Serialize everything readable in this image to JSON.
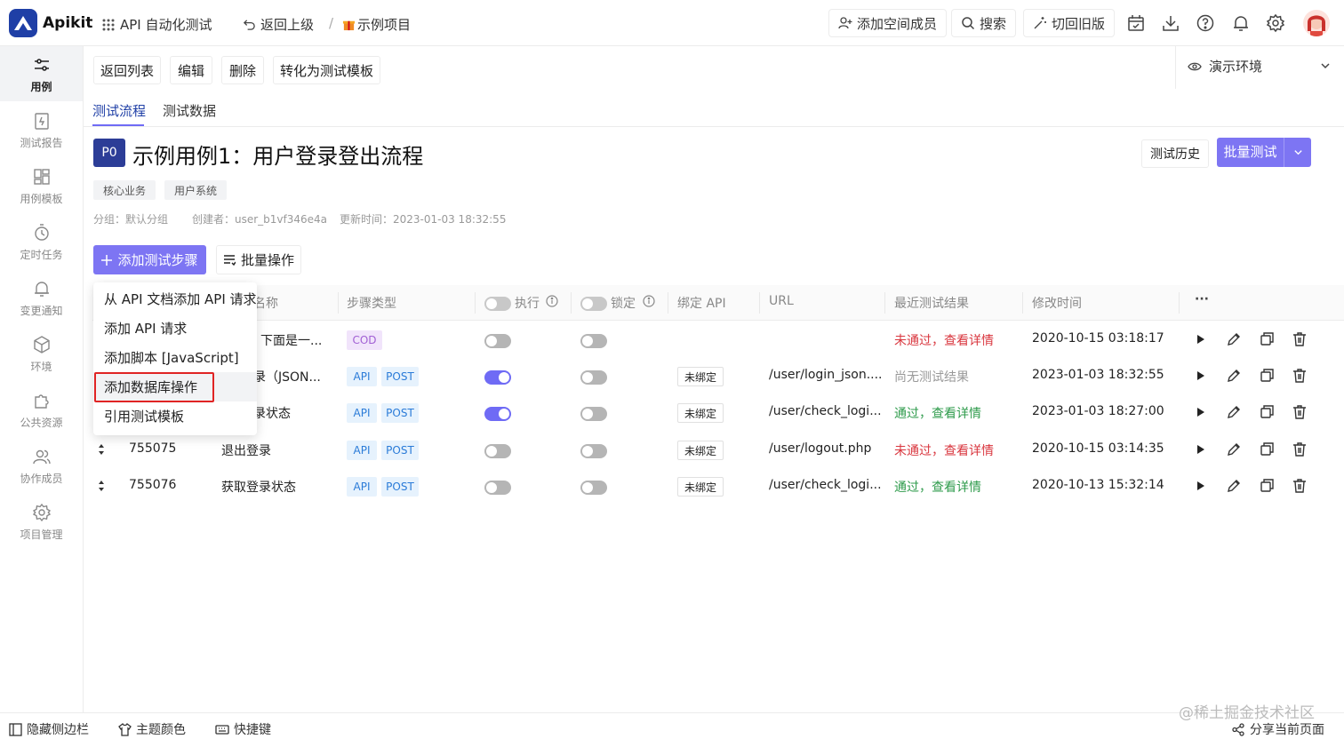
{
  "app": {
    "brand": "Apikit"
  },
  "topbar": {
    "module": "API 自动化测试",
    "back": "返回上级",
    "sep": "/",
    "project": "示例项目",
    "add_member": "添加空间成员",
    "search": "搜索",
    "old_version": "切回旧版"
  },
  "sidebar": {
    "items": [
      {
        "label": "用例",
        "icon": "sliders-icon"
      },
      {
        "label": "测试报告",
        "icon": "report-icon"
      },
      {
        "label": "用例模板",
        "icon": "template-icon"
      },
      {
        "label": "定时任务",
        "icon": "timer-icon"
      },
      {
        "label": "变更通知",
        "icon": "bell-icon"
      },
      {
        "label": "环境",
        "icon": "cube-icon"
      },
      {
        "label": "公共资源",
        "icon": "puzzle-icon"
      },
      {
        "label": "协作成员",
        "icon": "users-icon"
      },
      {
        "label": "项目管理",
        "icon": "gear-icon"
      }
    ]
  },
  "toolbar": {
    "back_list": "返回列表",
    "edit": "编辑",
    "delete": "删除",
    "to_template": "转化为测试模板",
    "env": "演示环境"
  },
  "tabs": [
    "测试流程",
    "测试数据"
  ],
  "case": {
    "priority": "P0",
    "title": "示例用例1：用户登录登出流程",
    "history": "测试历史",
    "batch_test": "批量测试",
    "tags": [
      "核心业务",
      "用户系统"
    ],
    "group": "分组：默认分组",
    "creator": "创建者：user_b1vf346e4a",
    "updated": "更新时间：2023-01-03 18:32:55"
  },
  "actions": {
    "add_step": "添加测试步骤",
    "bulk": "批量操作"
  },
  "table": {
    "headers": {
      "name": "名称",
      "type": "步骤类型",
      "exec": "执行",
      "lock": "锁定",
      "bind": "绑定 API",
      "url": "URL",
      "result": "最近测试结果",
      "modified": "修改时间",
      "more": "···"
    },
    "rows": [
      {
        "id": "",
        "name": "下面是一...",
        "types": [
          "COD"
        ],
        "exec": false,
        "lock": false,
        "bind": "",
        "url": "",
        "result": "未通过，查看详情",
        "result_kind": "fail",
        "modified": "2020-10-15 03:18:17"
      },
      {
        "id": "",
        "name": "录（JSON...",
        "types": [
          "API",
          "POST"
        ],
        "exec": true,
        "lock": false,
        "bind": "未绑定",
        "url": "/user/login_json....",
        "result": "尚无测试结果",
        "result_kind": "none",
        "modified": "2023-01-03 18:32:55"
      },
      {
        "id": "",
        "name": "录状态",
        "types": [
          "API",
          "POST"
        ],
        "exec": true,
        "lock": false,
        "bind": "未绑定",
        "url": "/user/check_logi...",
        "result": "通过，查看详情",
        "result_kind": "pass",
        "modified": "2023-01-03 18:27:00"
      },
      {
        "id": "755075",
        "name": "退出登录",
        "types": [
          "API",
          "POST"
        ],
        "exec": false,
        "lock": false,
        "bind": "未绑定",
        "url": "/user/logout.php",
        "result": "未通过，查看详情",
        "result_kind": "fail",
        "modified": "2020-10-15 03:14:35"
      },
      {
        "id": "755076",
        "name": "获取登录状态",
        "types": [
          "API",
          "POST"
        ],
        "exec": false,
        "lock": false,
        "bind": "未绑定",
        "url": "/user/check_logi...",
        "result": "通过，查看详情",
        "result_kind": "pass",
        "modified": "2020-10-13 15:32:14"
      }
    ]
  },
  "dropdown": {
    "items": [
      "从 API 文档添加 API 请求",
      "添加 API 请求",
      "添加脚本 [JavaScript]",
      "添加数据库操作",
      "引用测试模板"
    ]
  },
  "bottombar": {
    "hide_sidebar": "隐藏侧边栏",
    "theme": "主题颜色",
    "shortcuts": "快捷键",
    "share": "分享当前页面"
  },
  "watermark": "@稀土掘金技术社区"
}
